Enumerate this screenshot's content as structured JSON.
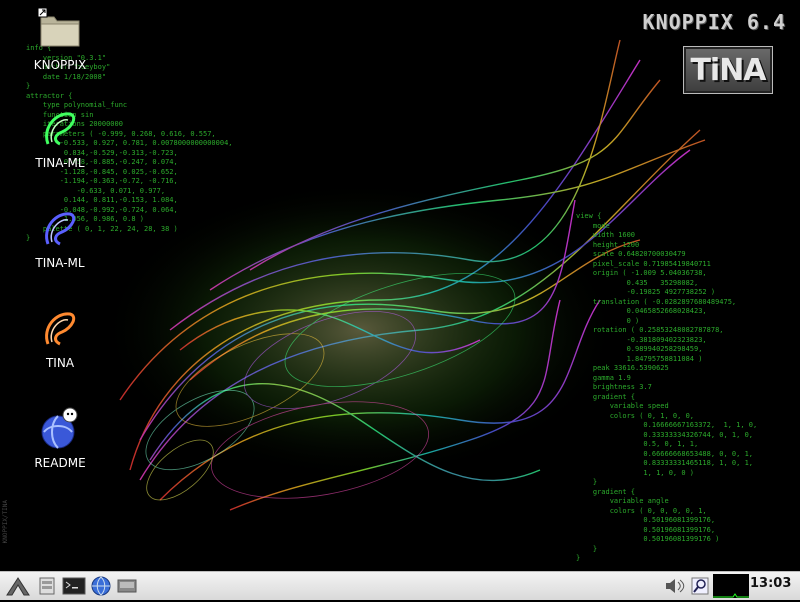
{
  "desktop": {
    "brand": "KNOPPIX 6.4",
    "logo_text": "TiNA",
    "side_tag": "KNOPPIX/TINA",
    "icons": [
      {
        "label": "KNOPPIX",
        "icon": "folder-icon"
      },
      {
        "label": "TINA-ML",
        "icon": "tina-ml-green-icon"
      },
      {
        "label": "TINA-ML",
        "icon": "tina-ml-blue-icon"
      },
      {
        "label": "TINA",
        "icon": "tina-orange-icon"
      },
      {
        "label": "README",
        "icon": "readme-globe-icon"
      }
    ],
    "code_left": "info {\n    version \"0.3.1\"\n    author \"beeyboy\"\n    date 1/18/2008\"\n}\nattractor {\n    type polynomial_func\n    function sin\n    iterations 20000000\n    parameters ( -0.999, 0.268, 0.616, 0.557,\n        -0.533, 0.927, 0.781, 0.0078000000000004,\n         0.834,-0.529,-0.313,-0.723,\n         0.458,-0.885,-0.247, 0.074,\n        -1.128,-0.845, 0.025,-0.652,\n        -1.194,-0.363,-0.72, -0.716,\n            -0.633, 0.071, 0.977,\n         0.144, 0.811,-0.153, 1.084,\n        -0.048,-0.992,-0.724, 0.064,\n         1.056, 0.986, 0.8 )\n    palette ( 0, 1, 22, 24, 28, 38 )\n}",
    "code_right": "view {\n    mode\n    width 1600\n    height 1200\n    scale 0.64820700030479\n    pixel_scale 0.71985419840711\n    origin ( -1.009 5.04036738,\n            0.435   35298082,\n            -0.19825 4927738252 )\n    translation ( -0.0282897680489475,\n            0.0465852668028423,\n            0 )\n    rotation ( 0.25853248082787878,\n            -0.381809402323823,\n            0.989940258298459,\n            1.84795758811084 )\n    peak 33616.5390625\n    gamma 1.9\n    brightness 3.7\n    gradient {\n        variable speed\n        colors ( 0, 1, 0, 0,\n                0.16666667163372,  1, 1, 0,\n                0.33333334326744, 0, 1, 0,\n                0.5, 0, 1, 1,\n                0.66666668653488, 0, 0, 1,\n                0.83333331465118, 1, 0, 1,\n                1, 1, 0, 0 )\n    }\n    gradient {\n        variable angle\n        colors ( 0, 0, 0, 0, 1,\n                0.50196081399176,\n                0.50196081399176,\n                0.50196081399176 )\n    }\n}"
  },
  "taskbar": {
    "clock": "13:03",
    "buttons": [
      "start-menu-icon",
      "file-manager-icon",
      "terminal-icon",
      "web-browser-icon",
      "show-desktop-icon"
    ],
    "tray": [
      "volume-icon",
      "search-icon",
      "cpu-monitor"
    ]
  },
  "colors": {
    "code_green": "#2cab2c",
    "taskbar": "#e6e6e6"
  }
}
